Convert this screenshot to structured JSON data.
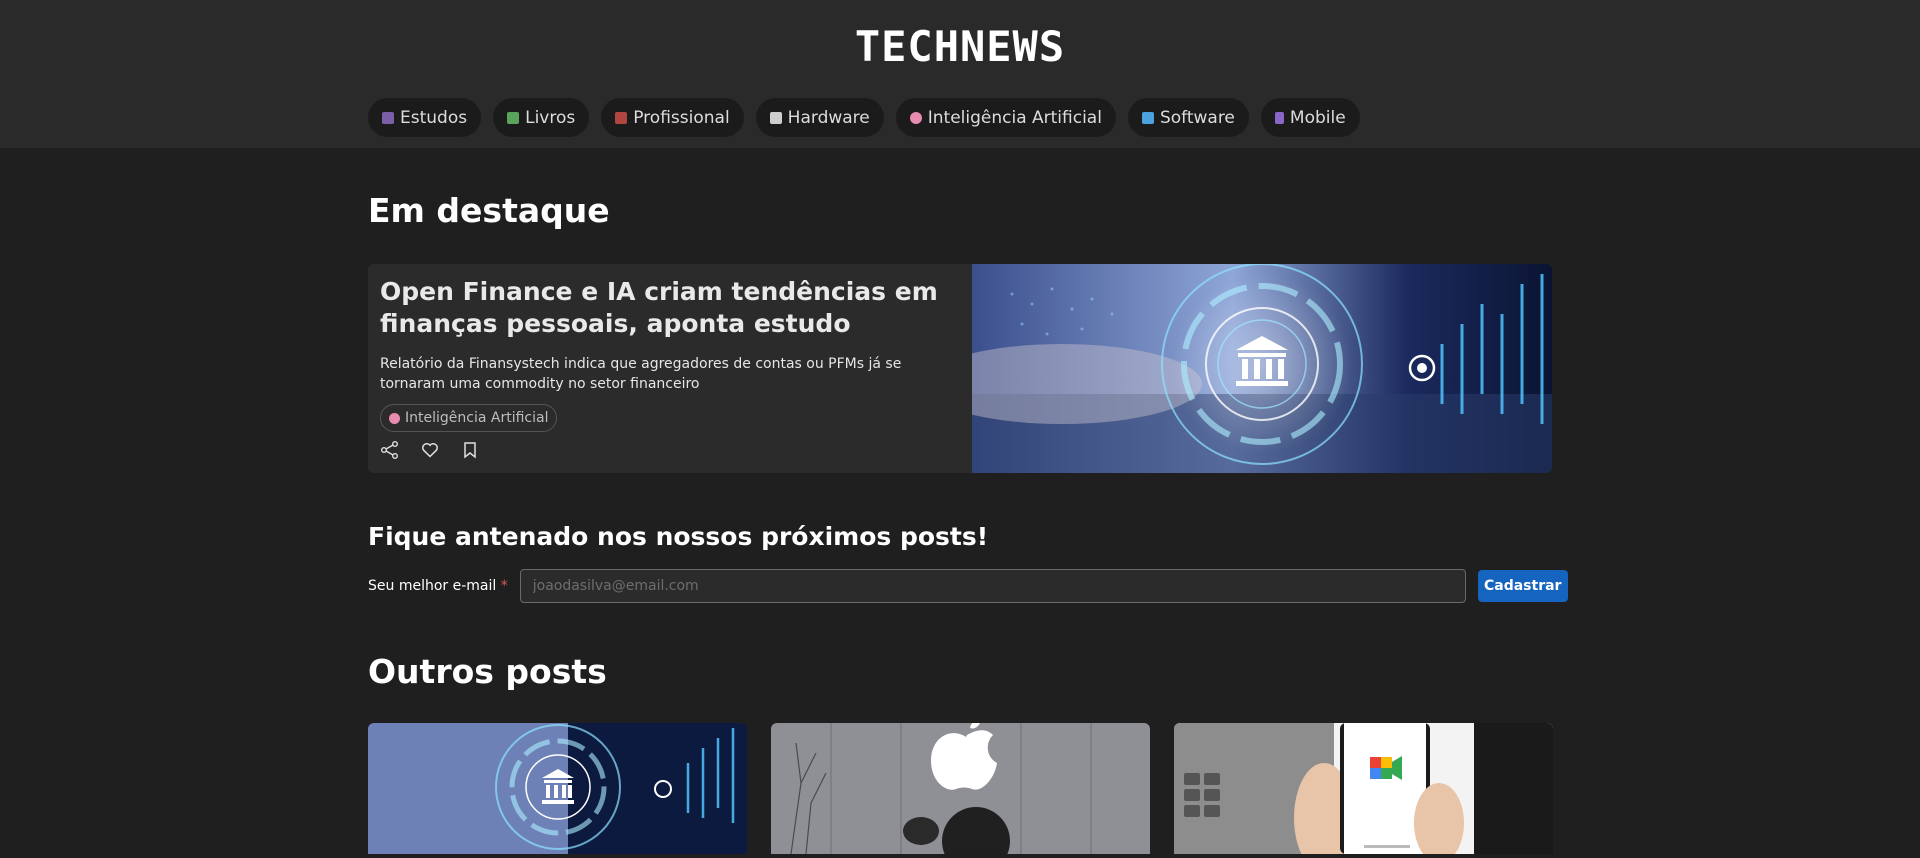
{
  "brand": "TECHNEWS",
  "categories": [
    {
      "label": "Estudos",
      "icon": "graduation-cap-icon",
      "color": "#7b5ea7"
    },
    {
      "label": "Livros",
      "icon": "books-icon",
      "color": "#5aa35a"
    },
    {
      "label": "Profissional",
      "icon": "briefcase-icon",
      "color": "#b0463f"
    },
    {
      "label": "Hardware",
      "icon": "keyboard-icon",
      "color": "#cfcfcf"
    },
    {
      "label": "Inteligência Artificial",
      "icon": "brain-icon",
      "color": "#e88bb0"
    },
    {
      "label": "Software",
      "icon": "laptop-icon",
      "color": "#4aa3df"
    },
    {
      "label": "Mobile",
      "icon": "mobile-phone-icon",
      "color": "#8a66c9"
    }
  ],
  "featured": {
    "heading": "Em destaque",
    "title": "Open Finance e IA criam tendências em finanças pessoais, aponta estudo",
    "description": "Relatório da Finansystech indica que agregadores de contas ou PFMs já se tornaram uma commodity no setor financeiro",
    "tag": "Inteligência Artificial"
  },
  "newsletter": {
    "heading": "Fique antenado nos nossos próximos posts!",
    "label": "Seu melhor e-mail",
    "required_mark": "*",
    "placeholder": "joaodasilva@email.com",
    "button": "Cadastrar"
  },
  "others": {
    "heading": "Outros posts"
  },
  "colors": {
    "accent": "#1565c0",
    "header_bg": "#2a2a2a",
    "page_bg": "#1f1f1f"
  }
}
